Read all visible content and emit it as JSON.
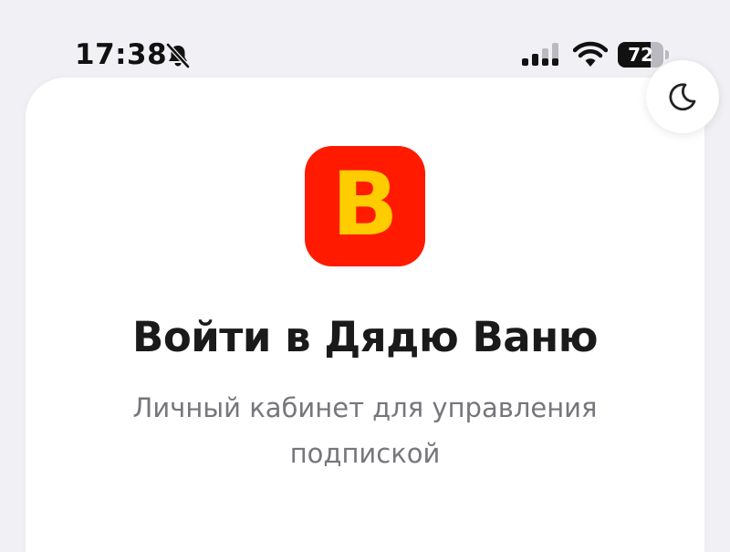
{
  "status_bar": {
    "time": "17:38",
    "battery_level": "72",
    "battery_fraction": 0.72,
    "icons": [
      "bell-slash-icon",
      "cellular-signal-icon",
      "wifi-icon",
      "battery-icon"
    ]
  },
  "theme_toggle": {
    "icon": "moon-icon"
  },
  "logo": {
    "letter": "В",
    "background_color": "#ff1a00",
    "letter_color": "#ffcc00"
  },
  "title": "Войти в Дядю Ваню",
  "subtitle": "Личный кабинет для управления подпиской"
}
